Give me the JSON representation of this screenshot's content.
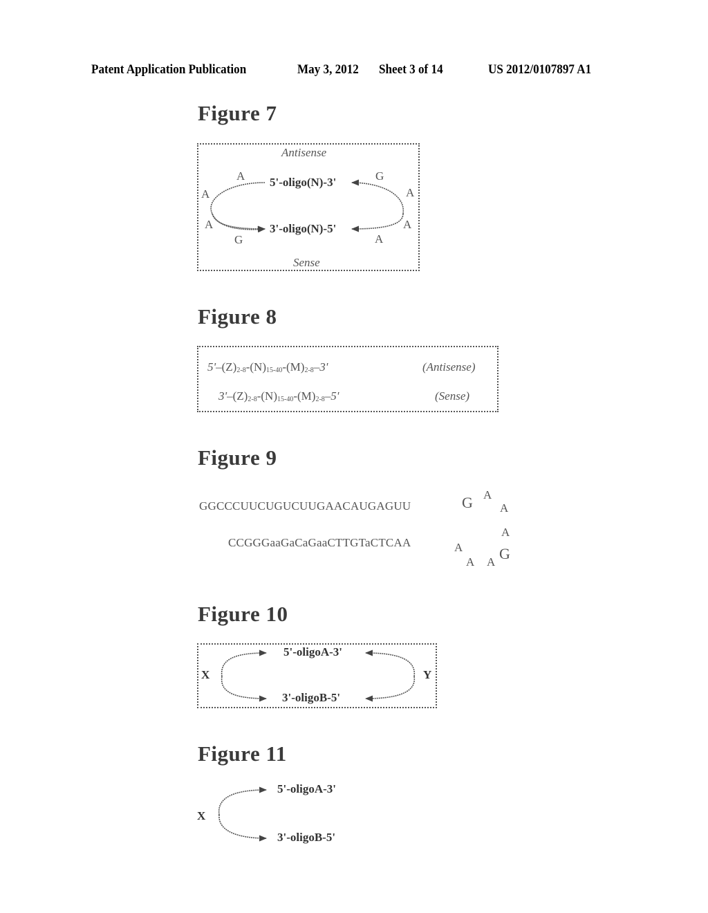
{
  "header": {
    "publication": "Patent Application Publication",
    "date": "May 3, 2012",
    "sheet": "Sheet 3 of 14",
    "number": "US 2012/0107897 A1"
  },
  "figure7": {
    "title": "Figure 7",
    "top_label": "Antisense",
    "bottom_label": "Sense",
    "strand_top": "5'-oligo(N)-3'",
    "strand_bottom": "3'-oligo(N)-5'",
    "left_loop": [
      "A",
      "A",
      "A",
      "G"
    ],
    "right_loop": [
      "G",
      "A",
      "A",
      "A"
    ]
  },
  "figure8": {
    "title": "Figure 8",
    "rows": [
      {
        "end5": "5'",
        "z": "(Z)",
        "zsub": "2-8",
        "n": "(N)",
        "nsub": "15-40",
        "m": "(M)",
        "msub": "2-8",
        "end3": "3'",
        "label": "(Antisense)"
      },
      {
        "end5": "3'",
        "z": "(Z)",
        "zsub": "2-8",
        "n": "(N)",
        "nsub": "15-40",
        "m": "(M)",
        "msub": "2-8",
        "end3": "5'",
        "label": "(Sense)"
      }
    ]
  },
  "figure9": {
    "title": "Figure 9",
    "seq_top": "GGCCCUUCUGUCUUGAACAUGAGUU",
    "seq_bottom": "CCGGGaaGaCaGaaCTTGTaCTCAA",
    "loop": [
      "G",
      "A",
      "A",
      "A",
      "G",
      "A",
      "A",
      "A"
    ]
  },
  "figure10": {
    "title": "Figure 10",
    "strand_top": "5'-oligoA-3'",
    "strand_bottom": "3'-oligoB-5'",
    "left_label": "X",
    "right_label": "Y"
  },
  "figure11": {
    "title": "Figure 11",
    "strand_top": "5'-oligoA-3'",
    "strand_bottom": "3'-oligoB-5'",
    "left_label": "X"
  }
}
